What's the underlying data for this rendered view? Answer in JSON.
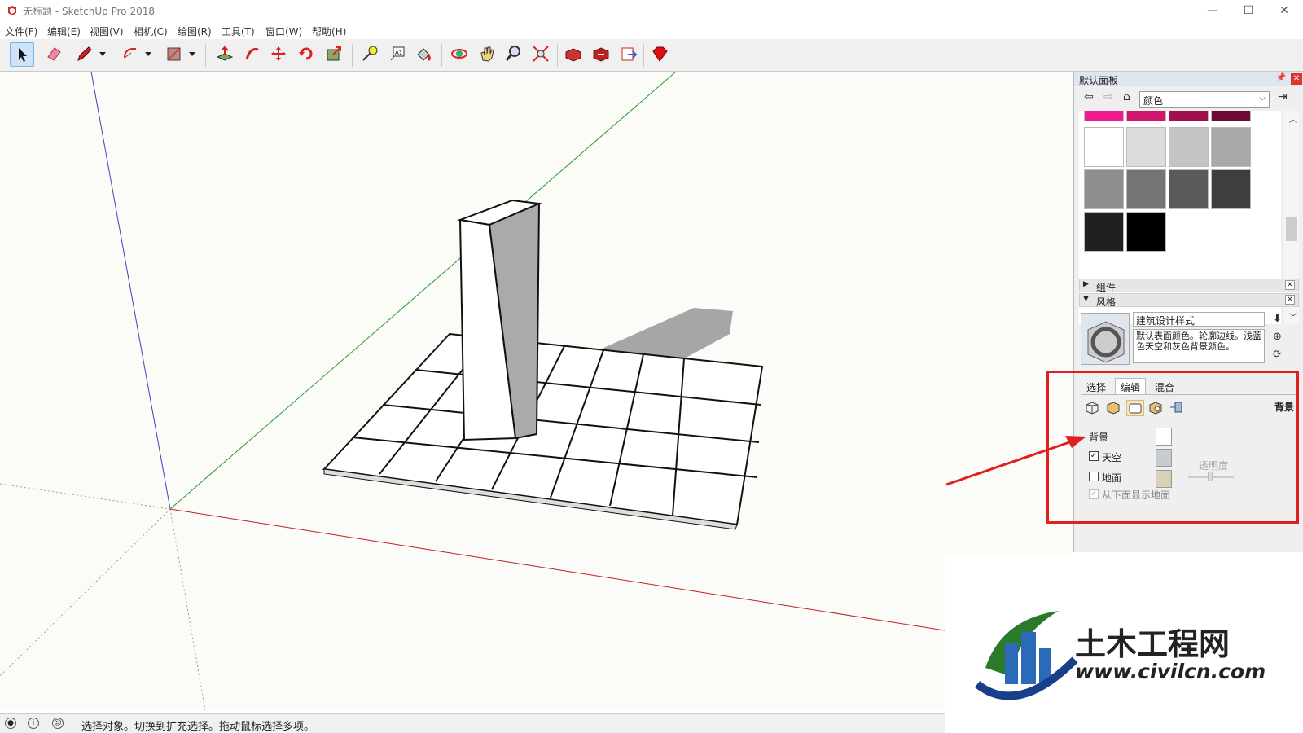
{
  "window": {
    "title": "无标题 - SketchUp Pro 2018",
    "minimize": "—",
    "maximize": "☐",
    "close": "✕"
  },
  "menu": [
    {
      "label": "文件(F)"
    },
    {
      "label": "编辑(E)"
    },
    {
      "label": "视图(V)"
    },
    {
      "label": "相机(C)"
    },
    {
      "label": "绘图(R)"
    },
    {
      "label": "工具(T)"
    },
    {
      "label": "窗口(W)"
    },
    {
      "label": "帮助(H)"
    }
  ],
  "toolbar": {
    "tools": [
      "select-tool",
      "eraser-tool",
      "pencil-tool",
      "arc-tool",
      "rectangle-tool",
      "push-pull-tool",
      "follow-me-tool",
      "move-tool",
      "rotate-tool",
      "scale-tool",
      "tape-measure-tool",
      "text-tool",
      "paint-bucket-tool",
      "orbit-tool",
      "pan-tool",
      "zoom-tool",
      "zoom-extents-tool",
      "warehouse-tool",
      "extension-warehouse-tool",
      "send-to-layout-tool",
      "ruby-tool"
    ]
  },
  "panel": {
    "title": "默认面板",
    "materials": {
      "selected": "颜色",
      "swatches": [
        "#ee1c8e",
        "#d0156e",
        "#a0104f",
        "#6a0a35",
        "#ffffff",
        "#dcdcdc",
        "#c4c4c4",
        "#a8a8a8",
        "#8e8e8e",
        "#747474",
        "#5a5a5a",
        "#3e3e3e",
        "#202020",
        "#000000"
      ]
    },
    "groups": {
      "components": "组件",
      "styles": "风格"
    },
    "style": {
      "name": "建筑设计样式",
      "description": "默认表面颜色。轮廓边线。浅蓝色天空和灰色背景颜色。"
    },
    "tabs": [
      {
        "label": "选择"
      },
      {
        "label": "编辑"
      },
      {
        "label": "混合"
      }
    ],
    "edit": {
      "title": "背景",
      "background_label": "背景",
      "background_color": "#ffffff",
      "sky_label": "天空",
      "sky_checked": "✓",
      "sky_color": "#c8ccd2",
      "ground_label": "地面",
      "ground_color": "#d6d2b8",
      "opacity_label": "透明度",
      "ground_under_label": "从下面显示地面"
    }
  },
  "statusbar": {
    "text": "选择对象。切换到扩充选择。拖动鼠标选择多项。"
  },
  "watermark": {
    "title": "土木工程网",
    "url": "www.civilcn.com"
  }
}
